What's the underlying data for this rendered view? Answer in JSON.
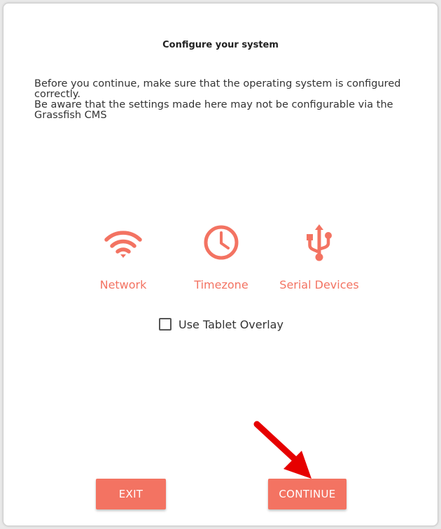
{
  "dialog": {
    "title": "Configure your system",
    "intro_line1": "Before you continue, make sure that the operating system is configured correctly.",
    "intro_line2": "Be aware that the settings made here may not be configurable via the Grassfish CMS"
  },
  "options": [
    {
      "label": "Network",
      "icon": "wifi-icon"
    },
    {
      "label": "Timezone",
      "icon": "clock-icon"
    },
    {
      "label": "Serial Devices",
      "icon": "usb-icon"
    }
  ],
  "tablet_overlay": {
    "label": "Use Tablet Overlay",
    "checked": false
  },
  "buttons": {
    "exit_label": "EXIT",
    "continue_label": "CONTINUE"
  },
  "colors": {
    "accent": "#f37362",
    "annotation_arrow": "#e60000"
  }
}
